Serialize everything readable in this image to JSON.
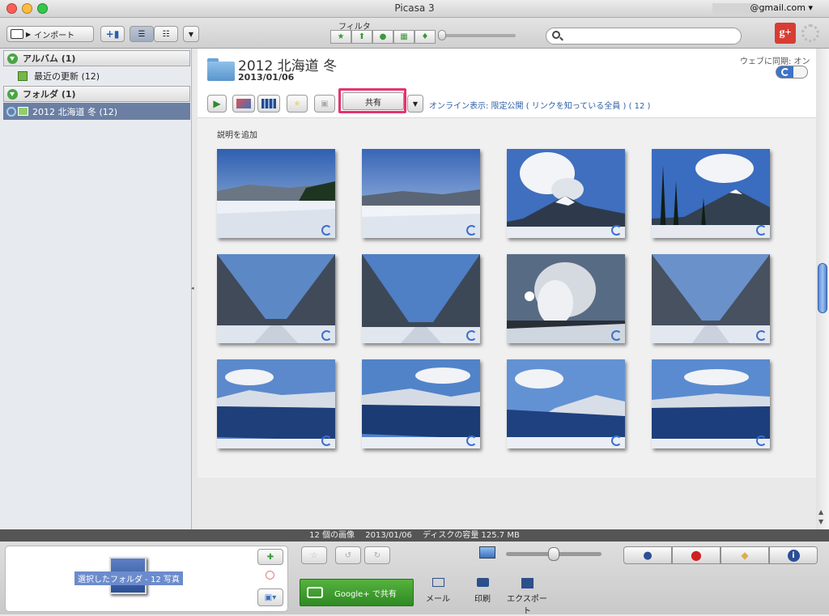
{
  "window": {
    "title": "Picasa 3",
    "account": "@gmail.com ▾"
  },
  "toolbar": {
    "import_label": "インポート",
    "filter_label": "フィルタ",
    "search_placeholder": ""
  },
  "sidebar": {
    "albums_header": "アルバム (1)",
    "albums": [
      {
        "label": "最近の更新 (12)"
      }
    ],
    "folders_header": "フォルダ (1)",
    "folders": [
      {
        "label": "2012 北海道 冬 (12)"
      }
    ]
  },
  "album": {
    "title": "2012 北海道 冬",
    "date": "2013/01/06",
    "web_sync_label": "ウェブに同期: オン",
    "share_label": "共有",
    "online_label": "オンライン表示: 限定公開 ( リンクを知っている全員 ) ( 12 )",
    "caption_label": "説明を追加"
  },
  "photos": [
    {
      "kind": "snowfield"
    },
    {
      "kind": "snowfield2"
    },
    {
      "kind": "volcano"
    },
    {
      "kind": "volcano_trees"
    },
    {
      "kind": "forest_road"
    },
    {
      "kind": "forest_road2"
    },
    {
      "kind": "steam"
    },
    {
      "kind": "forest_road3"
    },
    {
      "kind": "lake"
    },
    {
      "kind": "lake2"
    },
    {
      "kind": "lake3"
    },
    {
      "kind": "lake4"
    }
  ],
  "status": {
    "text": "12 個の画像　 2013/01/06　 ディスクの容量 125.7 MB"
  },
  "tray": {
    "selection_label": "選択したフォルダ - 12 写真"
  },
  "actions": {
    "gplus_share": "Google+ で共有",
    "mail": "メール",
    "print": "印刷",
    "export": "エクスポート"
  },
  "colors": {
    "share_highlight": "#e6336e",
    "gplus_green": "#3f9a2d",
    "selection_blue": "#6b7fa3",
    "gplus_red": "#d73d32"
  }
}
